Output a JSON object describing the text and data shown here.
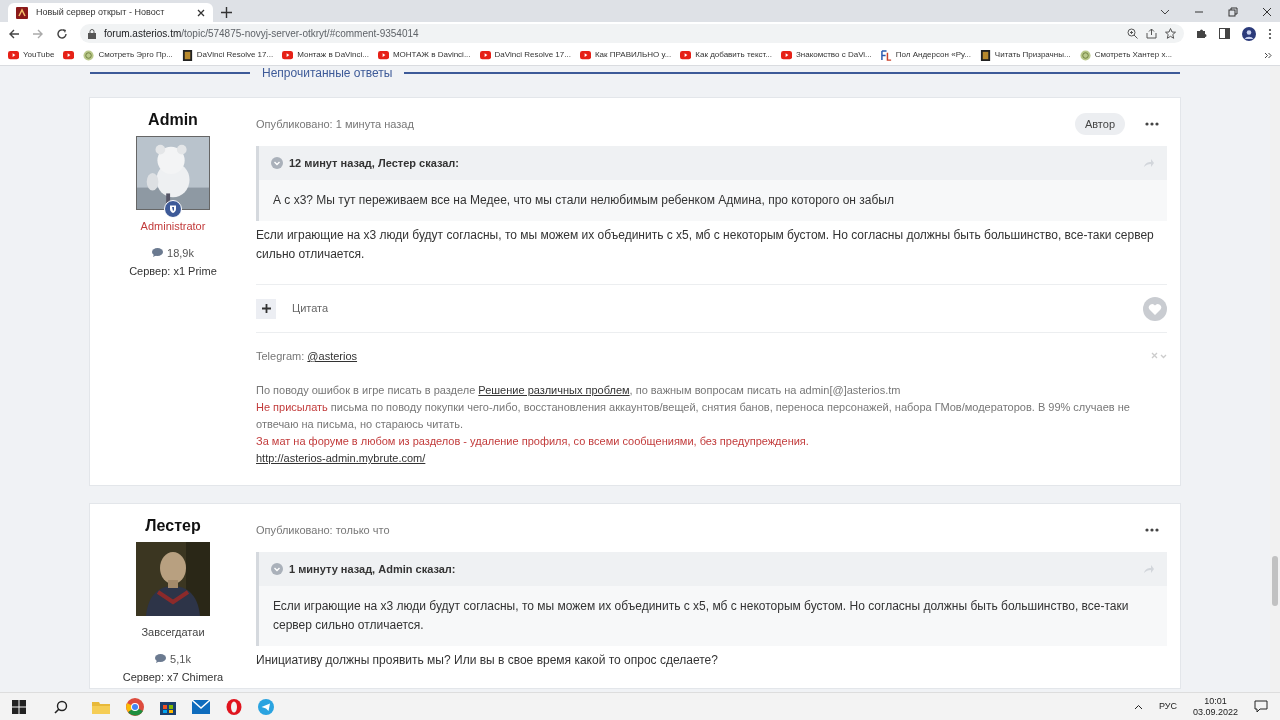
{
  "browser": {
    "tabs": [
      {
        "title": "Новый сервер открыт - Новост",
        "selected": true
      }
    ],
    "url_host": "forum.asterios.tm",
    "url_path": "/topic/574875-novyj-server-otkryt/#comment-9354014",
    "bookmarks": [
      {
        "kind": "video",
        "label": "YouTube"
      },
      {
        "kind": "video"
      },
      {
        "kind": "emblem",
        "label": "Смотреть Эрго Пр..."
      },
      {
        "kind": "tile",
        "label": "DaVinci Resolve 17..."
      },
      {
        "kind": "video",
        "label": "Монтаж в DaVinci..."
      },
      {
        "kind": "video",
        "label": "МОНТАЖ в Davinci..."
      },
      {
        "kind": "video",
        "label": "DaVinci Resolve 17..."
      },
      {
        "kind": "video",
        "label": "Как ПРАВИЛЬНО у..."
      },
      {
        "kind": "video",
        "label": "Как добавить текст..."
      },
      {
        "kind": "video",
        "label": "Знакомство с DaVi..."
      },
      {
        "kind": "monogram",
        "label": "Пол Андерсон «Ру..."
      },
      {
        "kind": "tile",
        "label": "Читать Призрачны..."
      },
      {
        "kind": "emblem",
        "label": "Смотреть Хантер х..."
      }
    ]
  },
  "section_heading": "Непрочитанные ответы",
  "posts": [
    {
      "author": "Admin",
      "staff": true,
      "role": "Administrator",
      "post_count": "18,9k",
      "server": "Сервер: x1 Prime",
      "posted": "Опубликовано: 1 минута назад",
      "author_badge": "Автор",
      "quote": {
        "header": "12 минут назад, Лестер сказал:",
        "text": "А с х3? Мы тут переживаем все на Медее, что мы стали нелюбимым ребенком Админа, про которого он забыл"
      },
      "body": "Если играющие на х3 люди будут согласны, то мы можем их объединить с х5, мб с некоторым бустом. Но согласны должны быть большинство, все-таки сервер сильно отличается.",
      "quote_action": "Цитата",
      "signature": [
        [
          {
            "kind": "text",
            "text": "Telegram: "
          },
          {
            "kind": "link",
            "text": "@asterios"
          }
        ],
        [
          {
            "kind": "text",
            "text": "По поводу ошибок в игре писать в разделе "
          },
          {
            "kind": "link",
            "text": "Решение различных проблем"
          },
          {
            "kind": "text",
            "text": ", по важным вопросам писать на admin[@]asterios.tm"
          }
        ],
        [
          {
            "kind": "warning",
            "text": "Не присылать"
          },
          {
            "kind": "text",
            "text": " письма по поводу покупки чего-либо, восстановления аккаунтов/вещей, снятия банов, переноса персонажей, набора ГМов/модераторов. В 99% случаев не отвечаю на письма, но стараюсь читать."
          }
        ],
        [
          {
            "kind": "warning",
            "text": "За мат на форуме в любом из разделов - удаление профиля, со всеми сообщениями, без предупреждения."
          }
        ],
        [
          {
            "kind": "link",
            "text": "http://asterios-admin.mybrute.com/"
          }
        ]
      ]
    },
    {
      "author": "Лестер",
      "staff": false,
      "role": "Завсегдатаи",
      "post_count": "5,1k",
      "server": "Сервер: x7 Chimera",
      "posted": "Опубликовано: только что",
      "quote": {
        "header": "1 минуту назад, Admin сказал:",
        "text": "Если играющие на х3 люди будут согласны, то мы можем их объединить с х5, мб с некоторым бустом. Но согласны должны быть большинство, все-таки сервер сильно отличается."
      },
      "body": "Инициативу должны проявить мы? Или вы в свое время какой то опрос сделаете?"
    }
  ],
  "taskbar": {
    "language": "РУС",
    "time": "10:01",
    "date": "03.09.2022"
  }
}
